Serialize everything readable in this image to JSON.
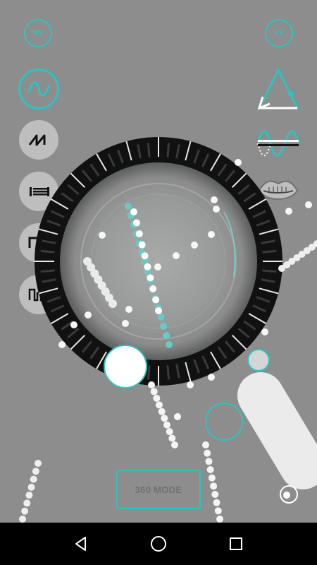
{
  "top_left_button": {
    "label": "MY"
  },
  "top_right_button": {
    "label": "FX"
  },
  "waveforms": [
    {
      "name": "sine",
      "selected": true
    },
    {
      "name": "sawtooth",
      "selected": false
    },
    {
      "name": "noise",
      "selected": false
    },
    {
      "name": "square",
      "selected": false
    },
    {
      "name": "pulse",
      "selected": false
    }
  ],
  "right_tools": [
    {
      "icon": "triangle-icon"
    },
    {
      "icon": "waveform-line-icon"
    },
    {
      "icon": "lips-icon"
    }
  ],
  "mode_button": {
    "label": "360 MODE"
  },
  "colors": {
    "accent": "#2ec4c4",
    "background": "#8c8d8c",
    "nav_bar": "#000000"
  },
  "nav": {
    "back": "back-icon",
    "home": "home-icon",
    "recents": "recents-icon"
  }
}
